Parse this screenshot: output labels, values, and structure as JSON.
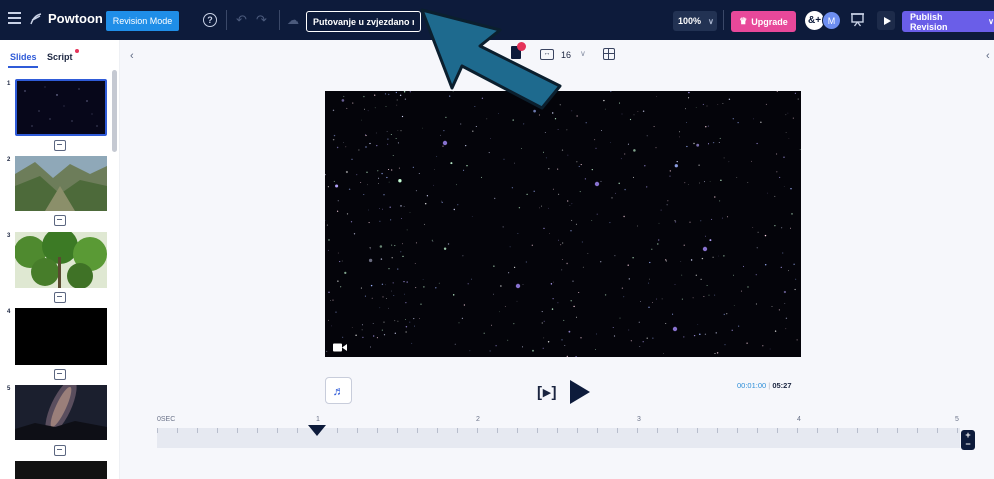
{
  "topbar": {
    "brand": "Powtoon",
    "revision_mode_label": "Revision Mode",
    "help_label": "?",
    "title_value": "Putovanje u zvjezdano n",
    "zoom_label": "100%",
    "upgrade_label": "Upgrade",
    "avatar_initial": "M",
    "publish_label": "Publish Revision"
  },
  "sidebar": {
    "tabs": [
      {
        "label": "Slides",
        "active": true
      },
      {
        "label": "Script",
        "active": false
      }
    ],
    "slides": [
      {
        "number": "1",
        "kind": "starfield",
        "selected": true
      },
      {
        "number": "2",
        "kind": "mountain-valley",
        "selected": false
      },
      {
        "number": "3",
        "kind": "green-trees",
        "selected": false
      },
      {
        "number": "4",
        "kind": "black",
        "selected": false
      },
      {
        "number": "5",
        "kind": "milky-way",
        "selected": false
      }
    ]
  },
  "canvas_controls": {
    "spacing_value": "16"
  },
  "player": {
    "current_time": "00:01:00",
    "total_time": "05:27"
  },
  "timeline": {
    "labels": [
      "0SEC",
      "1",
      "2",
      "3",
      "4",
      "5"
    ],
    "playhead_seconds": 1
  },
  "colors": {
    "topbar_bg": "#0d1b3b",
    "accent_blue": "#2f5bd8",
    "upgrade_pink": "#e8489a",
    "publish_purple": "#6a5ee8",
    "annotation_arrow": "#1e6a8e"
  },
  "icons": {
    "menu": "menu-icon",
    "logo": "powtoon-logo-icon",
    "help": "help-icon",
    "undo": "undo-icon",
    "redo": "redo-icon",
    "cloud": "cloud-save-icon",
    "upgrade": "crown-icon",
    "add_user": "add-user-icon",
    "present": "present-icon",
    "play": "play-icon",
    "music": "music-icon",
    "camera": "camera-icon",
    "grid": "grid-icon"
  }
}
